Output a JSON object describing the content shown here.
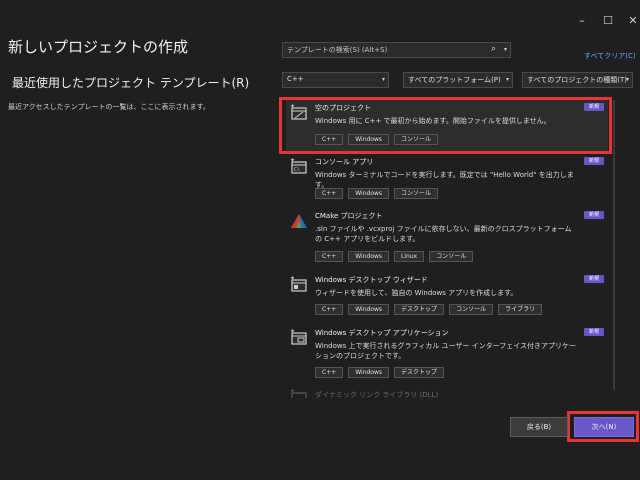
{
  "window": {
    "minimize_label": "–",
    "maximize_label": "☐",
    "close_label": "✕"
  },
  "header": {
    "title": "新しいプロジェクトの作成"
  },
  "recent": {
    "title": "最近使用したプロジェクト テンプレート(R)",
    "description": "最近アクセスしたテンプレートの一覧は、ここに表示されます。"
  },
  "search": {
    "placeholder": "テンプレートの検索(S) (Alt+S)",
    "clear_all": "すべてクリア(C)"
  },
  "filters": {
    "language": "C++",
    "platform": "すべてのプラットフォーム(P)",
    "project_type": "すべてのプロジェクトの種類(T)"
  },
  "templates": [
    {
      "name": "空のプロジェクト",
      "description": "Windows 用に C++ で最初から始めます。開始ファイルを提供しません。",
      "badge": "新規",
      "tags": [
        "C++",
        "Windows",
        "コンソール"
      ]
    },
    {
      "name": "コンソール アプリ",
      "description": "Windows ターミナルでコードを実行します。既定では \"Hello World\" を出力します。",
      "badge": "新規",
      "tags": [
        "C++",
        "Windows",
        "コンソール"
      ]
    },
    {
      "name": "CMake プロジェクト",
      "description": ".sln ファイルや .vcxproj ファイルに依存しない、最新のクロスプラットフォームの C++ アプリをビルドします。",
      "badge": "新規",
      "tags": [
        "C++",
        "Windows",
        "Linux",
        "コンソール"
      ]
    },
    {
      "name": "Windows デスクトップ ウィザード",
      "description": "ウィザードを使用して、独自の Windows アプリを作成します。",
      "badge": "新規",
      "tags": [
        "C++",
        "Windows",
        "デスクトップ",
        "コンソール",
        "ライブラリ"
      ]
    },
    {
      "name": "Windows デスクトップ アプリケーション",
      "description": "Windows 上で実行されるグラフィカル ユーザー インターフェイス付きアプリケーションのプロジェクトです。",
      "badge": "新規",
      "tags": [
        "C++",
        "Windows",
        "デスクトップ"
      ]
    },
    {
      "name": "ダイナミック リンク ライブラリ (DLL)"
    }
  ],
  "footer": {
    "back_label": "戻る(B)",
    "next_label": "次へ(N)"
  },
  "colors": {
    "accent": "#6a56c8",
    "highlight": "#e53535",
    "link": "#6ea9ff"
  }
}
